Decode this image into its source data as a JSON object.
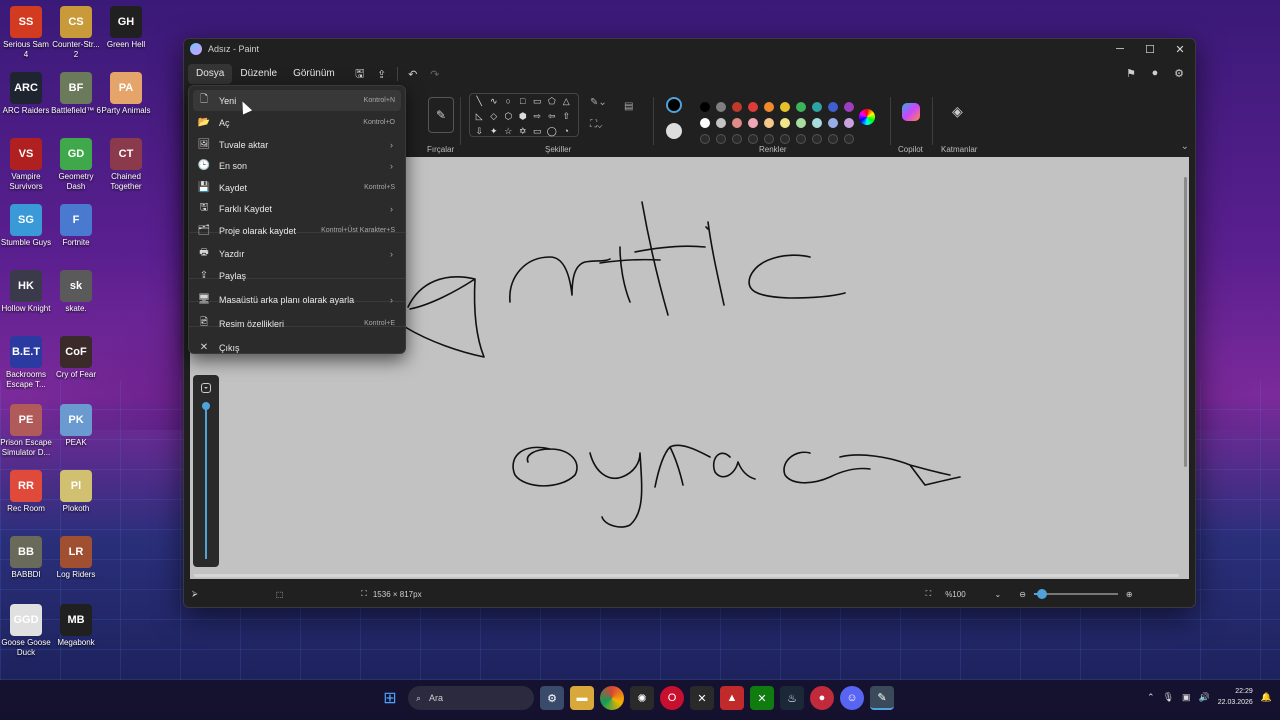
{
  "window": {
    "title": "Adsız - Paint",
    "menus": [
      "Dosya",
      "Düzenle",
      "Görünüm"
    ]
  },
  "ribbon": {
    "groups": {
      "brushes": "Fırçalar",
      "shapes": "Şekiller",
      "colors": "Renkler",
      "copilot": "Copilot",
      "layers": "Katmanlar"
    },
    "shape_icons": [
      "╲",
      "∿",
      "○",
      "□",
      "▭",
      "⬠",
      "△",
      "◺",
      "◇",
      "⬡",
      "⬢",
      "⇨",
      "⇦",
      "⇧",
      "⇩",
      "✦",
      "☆",
      "✡",
      "▭",
      "◯",
      "◔"
    ],
    "selected_colors": [
      "#000000",
      "#ffffff"
    ],
    "palette": [
      "#000000",
      "#7f7f7f",
      "#c0392b",
      "#e03a3a",
      "#f08a2a",
      "#e6c229",
      "#3cb55a",
      "#2ea3a3",
      "#3f5fd0",
      "#9b3fc0",
      "#ffffff",
      "#c3c3c3",
      "#e08a8a",
      "#f2a7b6",
      "#f5c88b",
      "#eee58a",
      "#a8dca0",
      "#a8dde0",
      "#98aee8",
      "#c9a2e0",
      "#2b2b2b",
      "#2b2b2b",
      "#2b2b2b",
      "#2b2b2b",
      "#2b2b2b",
      "#2b2b2b",
      "#2b2b2b",
      "#2b2b2b",
      "#2b2b2b",
      "#2b2b2b"
    ]
  },
  "file_menu": {
    "items": [
      {
        "icon": "new-file-icon",
        "glyph": "🗋",
        "label": "Yeni",
        "shortcut": "Kontrol+N",
        "arrow": ""
      },
      {
        "icon": "open-folder-icon",
        "glyph": "📂",
        "label": "Aç",
        "shortcut": "Kontrol+O",
        "arrow": ""
      },
      {
        "icon": "import-canvas-icon",
        "glyph": "🖼",
        "label": "Tuvale aktar",
        "shortcut": "",
        "arrow": "›"
      },
      {
        "icon": "recent-icon",
        "glyph": "🕒",
        "label": "En son",
        "shortcut": "",
        "arrow": "›"
      },
      {
        "icon": "save-icon",
        "glyph": "💾",
        "label": "Kaydet",
        "shortcut": "Kontrol+S",
        "arrow": ""
      },
      {
        "icon": "save-as-icon",
        "glyph": "🖫",
        "label": "Farklı Kaydet",
        "shortcut": "",
        "arrow": "›"
      },
      {
        "icon": "save-project-icon",
        "glyph": "🗂",
        "label": "Proje olarak kaydet",
        "shortcut": "Kontrol+Üst Karakter+S",
        "arrow": ""
      },
      {
        "icon": "print-icon",
        "glyph": "🖶",
        "label": "Yazdır",
        "shortcut": "",
        "arrow": "›"
      },
      {
        "icon": "share-icon",
        "glyph": "⇪",
        "label": "Paylaş",
        "shortcut": "",
        "arrow": ""
      },
      {
        "icon": "desktop-bg-icon",
        "glyph": "🖥",
        "label": "Masaüstü arka planı olarak ayarla",
        "shortcut": "",
        "arrow": "›"
      },
      {
        "icon": "image-properties-icon",
        "glyph": "🖻",
        "label": "Resim özellikleri",
        "shortcut": "Kontrol+E",
        "arrow": ""
      },
      {
        "icon": "exit-icon",
        "glyph": "✕",
        "label": "Çıkış",
        "shortcut": "",
        "arrow": ""
      }
    ]
  },
  "status": {
    "canvas_size": "1536 × 817px",
    "zoom": "%100",
    "zoom_fraction": 0.1
  },
  "desktop_icons": [
    {
      "label": "Serious Sam 4",
      "color": "#d23b1f",
      "abbr": "SS"
    },
    {
      "label": "Counter-Str... 2",
      "color": "#c89a3a",
      "abbr": "CS"
    },
    {
      "label": "Green Hell",
      "color": "#202020",
      "abbr": "GH"
    },
    {
      "label": "ARC Raiders",
      "color": "#1e2430",
      "abbr": "ARC"
    },
    {
      "label": "Battlefield™ 6",
      "color": "#6a7a5a",
      "abbr": "BF"
    },
    {
      "label": "Party Animals",
      "color": "#e5a56a",
      "abbr": "PA"
    },
    {
      "label": "Vampire Survivors",
      "color": "#b02020",
      "abbr": "VS"
    },
    {
      "label": "Geometry Dash",
      "color": "#3ea84a",
      "abbr": "GD"
    },
    {
      "label": "Chained Together",
      "color": "#8a3a4a",
      "abbr": "CT"
    },
    {
      "label": "Stumble Guys",
      "color": "#3a9ad8",
      "abbr": "SG"
    },
    {
      "label": "Fortnite",
      "color": "#4a7ad0",
      "abbr": "F"
    },
    {
      "label": "Hollow Knight",
      "color": "#3a3a4a",
      "abbr": "HK"
    },
    {
      "label": "skate.",
      "color": "#5a5a5a",
      "abbr": "sk"
    },
    {
      "label": "Backrooms Escape T...",
      "color": "#2a3aa0",
      "abbr": "B.E.T"
    },
    {
      "label": "Cry of Fear",
      "color": "#3a2a2a",
      "abbr": "CoF"
    },
    {
      "label": "Prison Escape Simulator D...",
      "color": "#b05a5a",
      "abbr": "PE"
    },
    {
      "label": "PEAK",
      "color": "#6a9ad0",
      "abbr": "PK"
    },
    {
      "label": "Rec Room",
      "color": "#e04a3a",
      "abbr": "RR"
    },
    {
      "label": "Plokoth",
      "color": "#d0c070",
      "abbr": "Pl"
    },
    {
      "label": "BABBDI",
      "color": "#6a6a5a",
      "abbr": "BB"
    },
    {
      "label": "Log Riders",
      "color": "#a05030",
      "abbr": "LR"
    },
    {
      "label": "Goose Goose Duck",
      "color": "#e0e0e0",
      "abbr": "GGD"
    },
    {
      "label": "Megabonk",
      "color": "#202020",
      "abbr": "MB"
    }
  ],
  "taskbar": {
    "search_placeholder": "Ara",
    "time": "22:29",
    "date": "22.03.2026"
  }
}
